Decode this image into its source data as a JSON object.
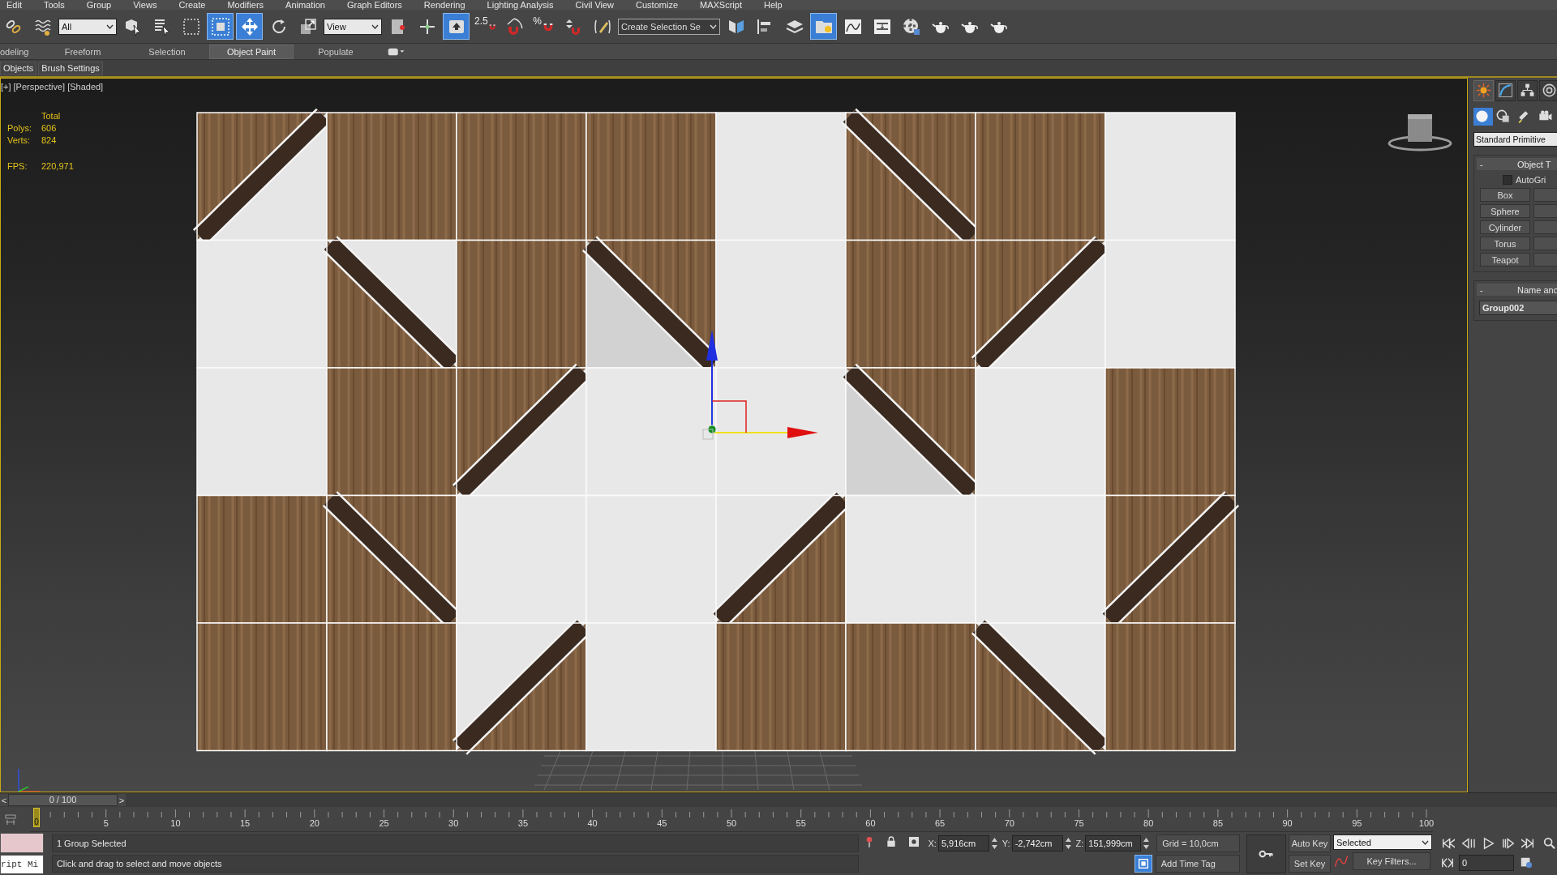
{
  "menu_bar": [
    "Edit",
    "Tools",
    "Group",
    "Views",
    "Create",
    "Modifiers",
    "Animation",
    "Graph Editors",
    "Rendering",
    "Lighting Analysis",
    "Civil View",
    "Customize",
    "MAXScript",
    "Help"
  ],
  "toolbar": [
    {
      "kind": "button",
      "selected": false
    },
    {
      "kind": "button",
      "selected": false
    },
    {
      "kind": "dropdown",
      "value": "All"
    },
    {
      "kind": "button",
      "selected": false
    },
    {
      "kind": "button",
      "selected": false
    },
    {
      "kind": "button",
      "selected": false
    },
    {
      "kind": "button",
      "selected": true
    },
    {
      "kind": "button",
      "selected": true
    },
    {
      "kind": "button",
      "selected": false
    },
    {
      "kind": "button",
      "selected": false
    },
    {
      "kind": "dropdown",
      "value": "View"
    },
    {
      "kind": "button",
      "selected": false
    },
    {
      "kind": "button",
      "selected": false
    },
    {
      "kind": "button",
      "selected": true
    },
    {
      "kind": "snap",
      "text": "2.5",
      "selected": false
    },
    {
      "kind": "button",
      "selected": false
    },
    {
      "kind": "snap",
      "text": "%",
      "selected": false
    },
    {
      "kind": "button",
      "selected": false
    },
    {
      "kind": "button",
      "selected": false
    },
    {
      "kind": "dropdown",
      "value": "Create Selection Se"
    },
    {
      "kind": "button",
      "selected": false
    },
    {
      "kind": "button",
      "selected": false
    },
    {
      "kind": "button",
      "selected": false
    },
    {
      "kind": "button",
      "selected": true
    },
    {
      "kind": "button",
      "selected": false
    },
    {
      "kind": "button",
      "selected": false
    },
    {
      "kind": "button",
      "selected": false
    },
    {
      "kind": "button",
      "selected": false
    },
    {
      "kind": "button",
      "selected": false
    },
    {
      "kind": "button",
      "selected": false
    }
  ],
  "ribbon_tabs": [
    {
      "label": "odeling",
      "selected": false
    },
    {
      "label": "Freeform",
      "selected": false
    },
    {
      "label": "Selection",
      "selected": false
    },
    {
      "label": "Object Paint",
      "selected": true
    },
    {
      "label": "Populate",
      "selected": false
    }
  ],
  "ribbon_panels": [
    "Objects",
    "Brush Settings"
  ],
  "viewport": {
    "labels": [
      "[+]",
      "[Perspective]",
      "[Shaded]"
    ],
    "stats_header": "Total",
    "stats": [
      {
        "label": "Polys:",
        "value": "606"
      },
      {
        "label": "Verts:",
        "value": "824"
      },
      {
        "label": "FPS:",
        "value": "220,971"
      }
    ]
  },
  "command_panel": {
    "tabs": [
      {
        "selected": true
      },
      {
        "selected": false
      },
      {
        "selected": false
      },
      {
        "selected": false
      }
    ],
    "categories": [
      {
        "selected": true
      },
      {
        "selected": false
      },
      {
        "selected": false
      },
      {
        "selected": false
      }
    ],
    "type_dropdown": "Standard Primitive",
    "object_type": {
      "sign": "-",
      "title": "Object T",
      "autogrid_label": "AutoGri",
      "autogrid_checked": false,
      "buttons": [
        "Box",
        "Sphere",
        "Cylinder",
        "Torus",
        "Teapot"
      ]
    },
    "name_color": {
      "sign": "-",
      "title": "Name and",
      "name": "Group002"
    }
  },
  "time_slider": {
    "prev": "<",
    "position": "0 / 100",
    "next": ">",
    "level": 0
  },
  "track": {
    "current_frame": "0",
    "ticks": [
      "5",
      "10",
      "15",
      "20",
      "25",
      "30",
      "35",
      "40",
      "45",
      "50",
      "55",
      "60",
      "65",
      "70",
      "75",
      "80",
      "85",
      "90",
      "95",
      "100"
    ]
  },
  "status": {
    "listener": "ript Mi",
    "selection_info": "1 Group Selected",
    "prompt": "Click and drag to select and move objects",
    "coords": [
      {
        "axis": "X:",
        "value": "5,916cm"
      },
      {
        "axis": "Y:",
        "value": "-2,742cm"
      },
      {
        "axis": "Z:",
        "value": "151,999cm"
      }
    ],
    "grid": "Grid = 10,0cm",
    "add_time_tag": "Add Time Tag",
    "auto_key": "Auto Key",
    "set_key": "Set Key",
    "key_mode": "Selected",
    "key_filters": "Key Filters...",
    "frame": "0"
  }
}
